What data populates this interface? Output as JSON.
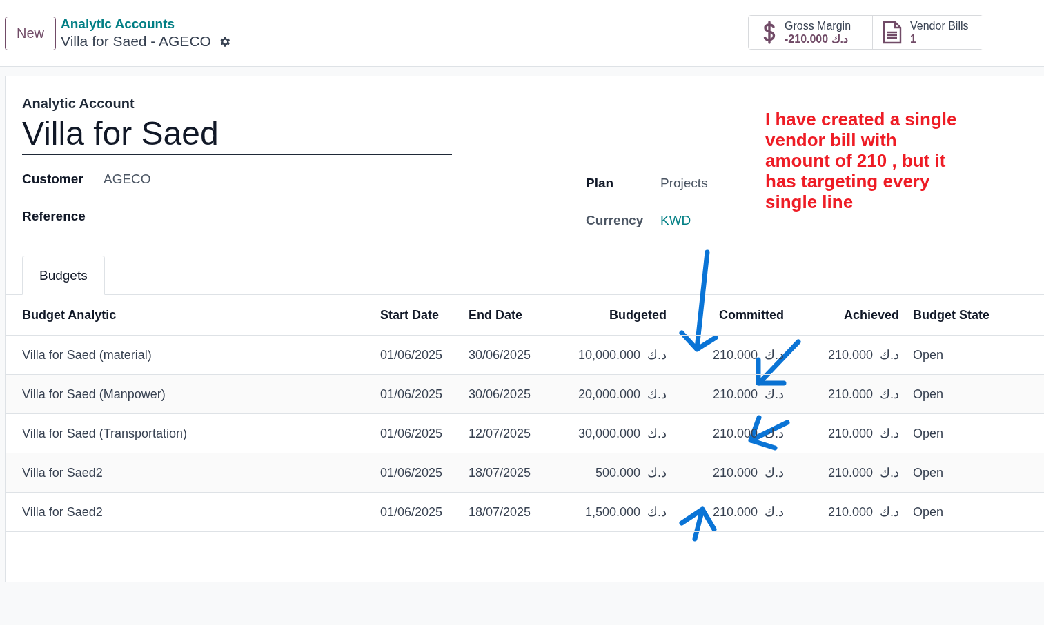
{
  "header": {
    "new_button": "New",
    "breadcrumb": "Analytic Accounts",
    "record_title": "Villa for Saed - AGECO"
  },
  "smart_buttons": [
    {
      "kind": "margin",
      "label": "Gross Margin",
      "value": "-210.000 د.ك"
    },
    {
      "kind": "bills",
      "label": "Vendor Bills",
      "value": "1"
    }
  ],
  "form": {
    "caption": "Analytic Account",
    "name": "Villa for Saed",
    "left_fields": [
      {
        "label": "Customer",
        "value": "AGECO"
      },
      {
        "label": "Reference"
      }
    ],
    "right_fields": [
      {
        "label": "Plan",
        "value": "Projects",
        "kind": "text"
      },
      {
        "label": "Currency",
        "value": "KWD",
        "kind": "link"
      }
    ]
  },
  "tabs": [
    {
      "label": "Budgets",
      "selected": true
    }
  ],
  "table": {
    "columns": [
      {
        "label": "Budget Analytic",
        "kind": "text"
      },
      {
        "label": "Start Date",
        "kind": "text"
      },
      {
        "label": "End Date",
        "kind": "text"
      },
      {
        "label": "Budgeted",
        "kind": "amount"
      },
      {
        "label": "Committed",
        "kind": "amount"
      },
      {
        "label": "Achieved",
        "kind": "amount"
      },
      {
        "label": "Budget State",
        "kind": "text"
      }
    ],
    "rows": [
      [
        "Villa for Saed (material)",
        "01/06/2025",
        "30/06/2025",
        "10,000.000  د.ك",
        "210.000  د.ك",
        "210.000  د.ك",
        "Open"
      ],
      [
        "Villa for Saed (Manpower)",
        "01/06/2025",
        "30/06/2025",
        "20,000.000  د.ك",
        "210.000  د.ك",
        "210.000  د.ك",
        "Open"
      ],
      [
        "Villa for Saed (Transportation)",
        "01/06/2025",
        "12/07/2025",
        "30,000.000  د.ك",
        "210.000  د.ك",
        "210.000  د.ك",
        "Open"
      ],
      [
        "Villa for Saed2",
        "01/06/2025",
        "18/07/2025",
        "500.000  د.ك",
        "210.000  د.ك",
        "210.000  د.ك",
        "Open"
      ],
      [
        "Villa for Saed2",
        "01/06/2025",
        "18/07/2025",
        "1,500.000  د.ك",
        "210.000  د.ك",
        "210.000  د.ك",
        "Open"
      ]
    ]
  },
  "annotation": {
    "note": "I have created a single\nvendor bill with\namount of 210 , but it\nhas targeting every\nsingle line"
  }
}
